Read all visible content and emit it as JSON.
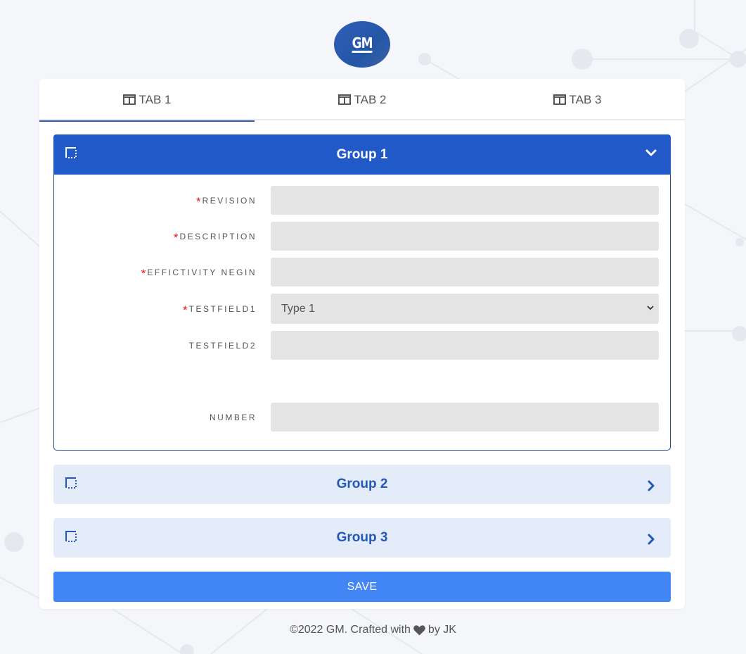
{
  "brand": {
    "logo_text": "GM",
    "accent": "#2159c9",
    "accent_light": "#e4ebf9",
    "save_color": "#4285f4"
  },
  "tabs": [
    {
      "label": "TAB 1",
      "icon": "table-icon",
      "active": true
    },
    {
      "label": "TAB 2",
      "icon": "table-icon",
      "active": false
    },
    {
      "label": "TAB 3",
      "icon": "table-icon",
      "active": false
    }
  ],
  "groups": [
    {
      "title": "Group 1",
      "icon": "border-style-icon",
      "expanded": true
    },
    {
      "title": "Group 2",
      "icon": "border-style-icon",
      "expanded": false
    },
    {
      "title": "Group 3",
      "icon": "border-style-icon",
      "expanded": false
    }
  ],
  "form": {
    "fields": [
      {
        "label": "REVISION",
        "required": "*",
        "value": ""
      },
      {
        "label": "DESCRIPTION",
        "required": "*",
        "value": ""
      },
      {
        "label": "EFFICTIVITY NEGIN",
        "required": "*",
        "value": ""
      },
      {
        "label": "TESTFIELD1",
        "required": "*",
        "value": "Type 1"
      },
      {
        "label": "TESTFIELD2",
        "required": "",
        "value": ""
      },
      {
        "label": "NUMBER",
        "required": "",
        "value": ""
      }
    ]
  },
  "save_label": "SAVE",
  "footer": {
    "prefix": "©2022 GM. Crafted with",
    "suffix": "by JK",
    "icon": "heart-icon"
  }
}
